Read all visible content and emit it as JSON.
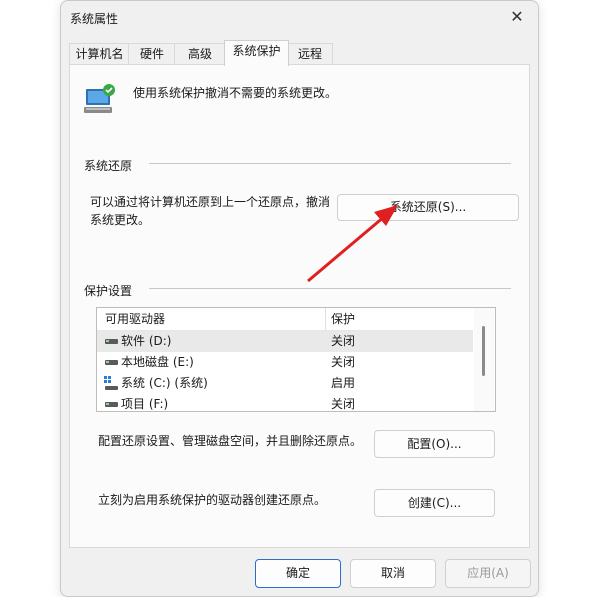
{
  "window": {
    "title": "系统属性",
    "close_glyph": "✕"
  },
  "tabs": [
    "计算机名",
    "硬件",
    "高级",
    "系统保护",
    "远程"
  ],
  "active_tab": "系统保护",
  "intro": "使用系统保护撤消不需要的系统更改。",
  "restore_group": {
    "label": "系统还原",
    "desc_line1": "可以通过将计算机还原到上一个还原点，撤消",
    "desc_line2": "系统更改。",
    "button": "系统还原(S)..."
  },
  "protection_group": {
    "label": "保护设置",
    "columns": [
      "可用驱动器",
      "保护"
    ],
    "rows": [
      {
        "drive": "软件 (D:)",
        "status": "关闭",
        "icon": "drive-icon",
        "selected": true
      },
      {
        "drive": "本地磁盘 (E:)",
        "status": "关闭",
        "icon": "drive-icon"
      },
      {
        "drive": "系统 (C:) (系统)",
        "status": "启用",
        "icon": "system-drive-icon"
      },
      {
        "drive": "项目 (F:)",
        "status": "关闭",
        "icon": "drive-icon"
      }
    ],
    "config_desc": "配置还原设置、管理磁盘空间，并且删除还原点。",
    "config_button": "配置(O)...",
    "create_desc": "立刻为启用系统保护的驱动器创建还原点。",
    "create_button": "创建(C)..."
  },
  "footer": {
    "ok": "确定",
    "cancel": "取消",
    "apply": "应用(A)"
  },
  "colors": {
    "accent_border": "#2c6ec7",
    "annotation_arrow": "#e02020"
  }
}
